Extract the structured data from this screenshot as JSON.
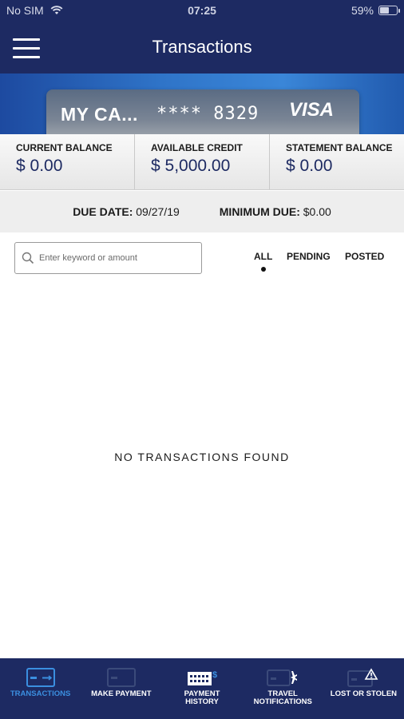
{
  "status_bar": {
    "carrier": "No SIM",
    "time": "07:25",
    "battery": "59%",
    "battery_level": 0.59
  },
  "header": {
    "title": "Transactions",
    "menu_icon": "hamburger-menu-icon"
  },
  "card": {
    "name": "MY CA...",
    "number": "**** 8329",
    "brand": "VISA"
  },
  "balances": {
    "current": {
      "label": "CURRENT BALANCE",
      "value": "$ 0.00"
    },
    "available": {
      "label": "AVAILABLE CREDIT",
      "value": "$ 5,000.00"
    },
    "statement": {
      "label": "STATEMENT BALANCE",
      "value": "$ 0.00"
    }
  },
  "due": {
    "date_label": "DUE DATE:",
    "date_value": "09/27/19",
    "min_label": "MINIMUM DUE:",
    "min_value": "$0.00"
  },
  "search": {
    "placeholder": "Enter keyword or amount",
    "icon": "search-icon"
  },
  "filters": {
    "all": "ALL",
    "pending": "PENDING",
    "posted": "POSTED",
    "selected": "ALL"
  },
  "empty_state": {
    "message": "NO TRANSACTIONS FOUND"
  },
  "bottom_nav": {
    "items": [
      {
        "label": "TRANSACTIONS",
        "icon": "credit-card-icon",
        "active": true
      },
      {
        "label": "MAKE PAYMENT",
        "icon": "card-payment-icon",
        "active": false
      },
      {
        "label": "PAYMENT\nHISTORY",
        "icon": "calendar-dollar-icon",
        "active": false
      },
      {
        "label": "TRAVEL\nNOTIFICATIONS",
        "icon": "card-airplane-icon",
        "active": false
      },
      {
        "label": "LOST OR STOLEN",
        "icon": "card-warning-icon",
        "active": false
      }
    ]
  },
  "colors": {
    "navy": "#1d2a62",
    "accent_blue": "#3b8fe0",
    "balance_value": "#1d2a62"
  }
}
